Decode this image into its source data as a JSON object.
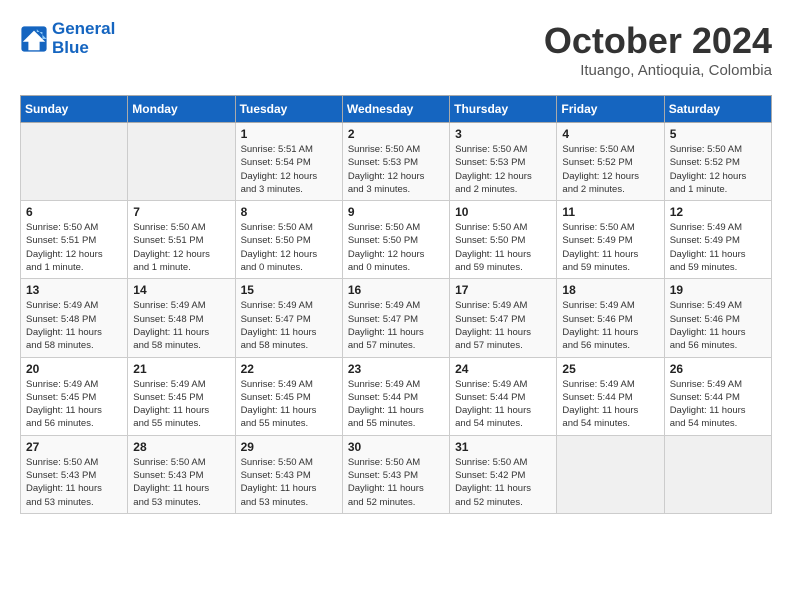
{
  "header": {
    "logo_line1": "General",
    "logo_line2": "Blue",
    "month": "October 2024",
    "location": "Ituango, Antioquia, Colombia"
  },
  "days_of_week": [
    "Sunday",
    "Monday",
    "Tuesday",
    "Wednesday",
    "Thursday",
    "Friday",
    "Saturday"
  ],
  "weeks": [
    [
      {
        "day": "",
        "info": ""
      },
      {
        "day": "",
        "info": ""
      },
      {
        "day": "1",
        "info": "Sunrise: 5:51 AM\nSunset: 5:54 PM\nDaylight: 12 hours\nand 3 minutes."
      },
      {
        "day": "2",
        "info": "Sunrise: 5:50 AM\nSunset: 5:53 PM\nDaylight: 12 hours\nand 3 minutes."
      },
      {
        "day": "3",
        "info": "Sunrise: 5:50 AM\nSunset: 5:53 PM\nDaylight: 12 hours\nand 2 minutes."
      },
      {
        "day": "4",
        "info": "Sunrise: 5:50 AM\nSunset: 5:52 PM\nDaylight: 12 hours\nand 2 minutes."
      },
      {
        "day": "5",
        "info": "Sunrise: 5:50 AM\nSunset: 5:52 PM\nDaylight: 12 hours\nand 1 minute."
      }
    ],
    [
      {
        "day": "6",
        "info": "Sunrise: 5:50 AM\nSunset: 5:51 PM\nDaylight: 12 hours\nand 1 minute."
      },
      {
        "day": "7",
        "info": "Sunrise: 5:50 AM\nSunset: 5:51 PM\nDaylight: 12 hours\nand 1 minute."
      },
      {
        "day": "8",
        "info": "Sunrise: 5:50 AM\nSunset: 5:50 PM\nDaylight: 12 hours\nand 0 minutes."
      },
      {
        "day": "9",
        "info": "Sunrise: 5:50 AM\nSunset: 5:50 PM\nDaylight: 12 hours\nand 0 minutes."
      },
      {
        "day": "10",
        "info": "Sunrise: 5:50 AM\nSunset: 5:50 PM\nDaylight: 11 hours\nand 59 minutes."
      },
      {
        "day": "11",
        "info": "Sunrise: 5:50 AM\nSunset: 5:49 PM\nDaylight: 11 hours\nand 59 minutes."
      },
      {
        "day": "12",
        "info": "Sunrise: 5:49 AM\nSunset: 5:49 PM\nDaylight: 11 hours\nand 59 minutes."
      }
    ],
    [
      {
        "day": "13",
        "info": "Sunrise: 5:49 AM\nSunset: 5:48 PM\nDaylight: 11 hours\nand 58 minutes."
      },
      {
        "day": "14",
        "info": "Sunrise: 5:49 AM\nSunset: 5:48 PM\nDaylight: 11 hours\nand 58 minutes."
      },
      {
        "day": "15",
        "info": "Sunrise: 5:49 AM\nSunset: 5:47 PM\nDaylight: 11 hours\nand 58 minutes."
      },
      {
        "day": "16",
        "info": "Sunrise: 5:49 AM\nSunset: 5:47 PM\nDaylight: 11 hours\nand 57 minutes."
      },
      {
        "day": "17",
        "info": "Sunrise: 5:49 AM\nSunset: 5:47 PM\nDaylight: 11 hours\nand 57 minutes."
      },
      {
        "day": "18",
        "info": "Sunrise: 5:49 AM\nSunset: 5:46 PM\nDaylight: 11 hours\nand 56 minutes."
      },
      {
        "day": "19",
        "info": "Sunrise: 5:49 AM\nSunset: 5:46 PM\nDaylight: 11 hours\nand 56 minutes."
      }
    ],
    [
      {
        "day": "20",
        "info": "Sunrise: 5:49 AM\nSunset: 5:45 PM\nDaylight: 11 hours\nand 56 minutes."
      },
      {
        "day": "21",
        "info": "Sunrise: 5:49 AM\nSunset: 5:45 PM\nDaylight: 11 hours\nand 55 minutes."
      },
      {
        "day": "22",
        "info": "Sunrise: 5:49 AM\nSunset: 5:45 PM\nDaylight: 11 hours\nand 55 minutes."
      },
      {
        "day": "23",
        "info": "Sunrise: 5:49 AM\nSunset: 5:44 PM\nDaylight: 11 hours\nand 55 minutes."
      },
      {
        "day": "24",
        "info": "Sunrise: 5:49 AM\nSunset: 5:44 PM\nDaylight: 11 hours\nand 54 minutes."
      },
      {
        "day": "25",
        "info": "Sunrise: 5:49 AM\nSunset: 5:44 PM\nDaylight: 11 hours\nand 54 minutes."
      },
      {
        "day": "26",
        "info": "Sunrise: 5:49 AM\nSunset: 5:44 PM\nDaylight: 11 hours\nand 54 minutes."
      }
    ],
    [
      {
        "day": "27",
        "info": "Sunrise: 5:50 AM\nSunset: 5:43 PM\nDaylight: 11 hours\nand 53 minutes."
      },
      {
        "day": "28",
        "info": "Sunrise: 5:50 AM\nSunset: 5:43 PM\nDaylight: 11 hours\nand 53 minutes."
      },
      {
        "day": "29",
        "info": "Sunrise: 5:50 AM\nSunset: 5:43 PM\nDaylight: 11 hours\nand 53 minutes."
      },
      {
        "day": "30",
        "info": "Sunrise: 5:50 AM\nSunset: 5:43 PM\nDaylight: 11 hours\nand 52 minutes."
      },
      {
        "day": "31",
        "info": "Sunrise: 5:50 AM\nSunset: 5:42 PM\nDaylight: 11 hours\nand 52 minutes."
      },
      {
        "day": "",
        "info": ""
      },
      {
        "day": "",
        "info": ""
      }
    ]
  ]
}
